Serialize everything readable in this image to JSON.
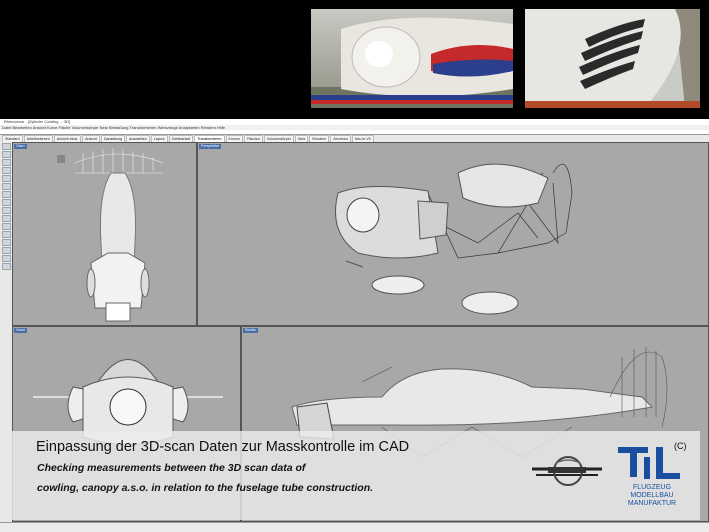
{
  "window": {
    "title": "Rhinoceros - [Zylinder Cowling ... 3D]",
    "menu": "Datei  Bearbeiten  Ansicht  Kurve  Fläche  Volumenkörper  Netz  Bemaßung  Transformieren  Werkzeuge  Analysieren  Rendern  Hilfe"
  },
  "tabs": [
    "Standard",
    "Arbeitsebenen",
    "Ansicht einst.",
    "Ansicht",
    "Darstellung",
    "Auswählen",
    "Layout",
    "Sichtbarkeit",
    "Transformieren",
    "Kurven",
    "Flächen",
    "Volumenkörper",
    "Netz",
    "Rendern",
    "Zeichnen",
    "Neu in V5"
  ],
  "viewports": {
    "top": "Oben",
    "perspective": "Perspektive",
    "front": "Vorne",
    "right": "Rechts"
  },
  "caption": {
    "title": "Einpassung der 3D-scan Daten zur Masskontrolle im CAD",
    "line1": "Checking measurements between the 3D scan data of",
    "line2": "cowling, canopy a.s.o. in relation to the fuselage tube construction.",
    "copyright": "(C)",
    "logo_text": "FLUGZEUG MODELLBAU MANUFAKTUR"
  },
  "colors": {
    "viewport_bg": "#a8a8a8",
    "logo_blue": "#1a4fa0",
    "caption_bg": "#ebebeb"
  }
}
